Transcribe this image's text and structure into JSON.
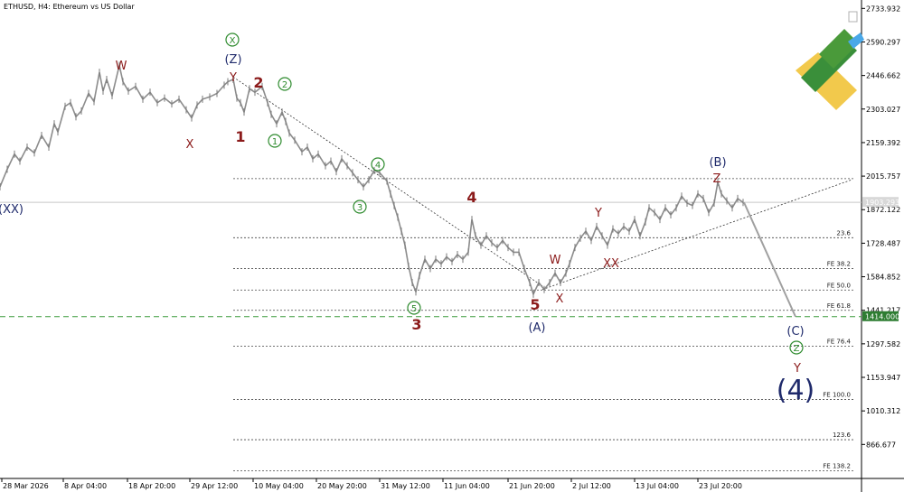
{
  "header": {
    "symbol_line": "ETHUSD, H4:  Ethereum vs US Dollar"
  },
  "chart_data": {
    "type": "line",
    "title": "ETHUSD, H4:  Ethereum vs US Dollar",
    "x_ticks": [
      "28 Mar 2026",
      "8 Apr 04:00",
      "18 Apr 20:00",
      "29 Apr 12:00",
      "10 May 04:00",
      "20 May 20:00",
      "31 May 12:00",
      "11 Jun 04:00",
      "21 Jun 20:00",
      "2 Jul 12:00",
      "13 Jul 04:00",
      "23 Jul 20:00"
    ],
    "y_ticks": [
      "2733.932",
      "2590.297",
      "2446.662",
      "2303.027",
      "2159.392",
      "2015.757",
      "1872.122",
      "1728.487",
      "1584.852",
      "1441.217",
      "1297.582",
      "1153.947",
      "1010.312",
      "866.677"
    ],
    "ylim": [
      721,
      2770
    ],
    "current_price_label": "1903.293",
    "target_price_label": "1414.000",
    "target_price": 1414.0,
    "fib_levels": [
      {
        "label": "",
        "price": 2005
      },
      {
        "label": "23.6",
        "price": 1752
      },
      {
        "label": "FE 38.2",
        "price": 1620
      },
      {
        "label": "FE 50.0",
        "price": 1528
      },
      {
        "label": "FE 61.8",
        "price": 1441
      },
      {
        "label": "FE 76.4",
        "price": 1287
      },
      {
        "label": "FE 100.0",
        "price": 1059
      },
      {
        "label": "123.6",
        "price": 887
      },
      {
        "label": "FE 138.2",
        "price": 754
      }
    ],
    "wave_labels": [
      {
        "text": "W",
        "color": "#8b1a1a",
        "style": "plain"
      },
      {
        "text": "X",
        "color": "#8b1a1a",
        "style": "plain"
      },
      {
        "text": "(XX)",
        "color": "#1f2a6b",
        "style": "plain"
      },
      {
        "text": "X",
        "color": "#2e8b2e",
        "style": "circle"
      },
      {
        "text": "(Z)",
        "color": "#1f2a6b",
        "style": "plain"
      },
      {
        "text": "Y",
        "color": "#8b1a1a",
        "style": "plain"
      },
      {
        "text": "2",
        "color": "#8b1a1a",
        "style": "bold"
      },
      {
        "text": "2",
        "color": "#2e8b2e",
        "style": "circle"
      },
      {
        "text": "1",
        "color": "#8b1a1a",
        "style": "bold"
      },
      {
        "text": "1",
        "color": "#2e8b2e",
        "style": "circle"
      },
      {
        "text": "4",
        "color": "#2e8b2e",
        "style": "circle"
      },
      {
        "text": "3",
        "color": "#2e8b2e",
        "style": "circle"
      },
      {
        "text": "5",
        "color": "#2e8b2e",
        "style": "circle"
      },
      {
        "text": "3",
        "color": "#8b1a1a",
        "style": "bold"
      },
      {
        "text": "4",
        "color": "#8b1a1a",
        "style": "bold"
      },
      {
        "text": "5",
        "color": "#8b1a1a",
        "style": "bold"
      },
      {
        "text": "(A)",
        "color": "#1f2a6b",
        "style": "plain"
      },
      {
        "text": "W",
        "color": "#8b1a1a",
        "style": "plain"
      },
      {
        "text": "X",
        "color": "#8b1a1a",
        "style": "plain"
      },
      {
        "text": "XX",
        "color": "#8b1a1a",
        "style": "plain"
      },
      {
        "text": "Y",
        "color": "#8b1a1a",
        "style": "plain"
      },
      {
        "text": "(B)",
        "color": "#1f2a6b",
        "style": "plain"
      },
      {
        "text": "Z",
        "color": "#8b1a1a",
        "style": "plain"
      },
      {
        "text": "(C)",
        "color": "#1f2a6b",
        "style": "plain"
      },
      {
        "text": "Z",
        "color": "#2e8b2e",
        "style": "circle"
      },
      {
        "text": "Y",
        "color": "#8b1a1a",
        "style": "plain"
      },
      {
        "text": "(4)",
        "color": "#1f2a6b",
        "style": "big"
      }
    ],
    "price_path": [
      [
        0,
        1970
      ],
      [
        8,
        2045
      ],
      [
        16,
        2110
      ],
      [
        22,
        2080
      ],
      [
        30,
        2140
      ],
      [
        38,
        2115
      ],
      [
        46,
        2190
      ],
      [
        54,
        2140
      ],
      [
        60,
        2240
      ],
      [
        64,
        2205
      ],
      [
        72,
        2315
      ],
      [
        78,
        2330
      ],
      [
        84,
        2270
      ],
      [
        90,
        2295
      ],
      [
        98,
        2370
      ],
      [
        104,
        2335
      ],
      [
        110,
        2460
      ],
      [
        114,
        2380
      ],
      [
        118,
        2430
      ],
      [
        124,
        2360
      ],
      [
        132,
        2490
      ],
      [
        136,
        2420
      ],
      [
        142,
        2380
      ],
      [
        150,
        2400
      ],
      [
        158,
        2345
      ],
      [
        166,
        2375
      ],
      [
        174,
        2330
      ],
      [
        182,
        2350
      ],
      [
        190,
        2325
      ],
      [
        198,
        2345
      ],
      [
        206,
        2300
      ],
      [
        212,
        2265
      ],
      [
        218,
        2320
      ],
      [
        224,
        2345
      ],
      [
        232,
        2355
      ],
      [
        240,
        2370
      ],
      [
        248,
        2405
      ],
      [
        252,
        2420
      ],
      [
        258,
        2430
      ],
      [
        262,
        2350
      ],
      [
        266,
        2330
      ],
      [
        270,
        2290
      ],
      [
        276,
        2390
      ],
      [
        282,
        2375
      ],
      [
        290,
        2400
      ],
      [
        296,
        2330
      ],
      [
        300,
        2280
      ],
      [
        306,
        2240
      ],
      [
        312,
        2290
      ],
      [
        316,
        2250
      ],
      [
        320,
        2200
      ],
      [
        326,
        2170
      ],
      [
        334,
        2120
      ],
      [
        340,
        2140
      ],
      [
        346,
        2090
      ],
      [
        352,
        2110
      ],
      [
        360,
        2060
      ],
      [
        366,
        2080
      ],
      [
        372,
        2035
      ],
      [
        378,
        2090
      ],
      [
        384,
        2060
      ],
      [
        390,
        2030
      ],
      [
        396,
        2000
      ],
      [
        402,
        1970
      ],
      [
        408,
        2000
      ],
      [
        414,
        2040
      ],
      [
        420,
        2030
      ],
      [
        428,
        1995
      ],
      [
        432,
        1940
      ],
      [
        436,
        1890
      ],
      [
        440,
        1840
      ],
      [
        444,
        1780
      ],
      [
        448,
        1720
      ],
      [
        452,
        1630
      ],
      [
        456,
        1560
      ],
      [
        460,
        1520
      ],
      [
        464,
        1590
      ],
      [
        470,
        1660
      ],
      [
        476,
        1620
      ],
      [
        482,
        1660
      ],
      [
        488,
        1640
      ],
      [
        494,
        1670
      ],
      [
        500,
        1650
      ],
      [
        506,
        1680
      ],
      [
        512,
        1660
      ],
      [
        518,
        1690
      ],
      [
        522,
        1830
      ],
      [
        526,
        1760
      ],
      [
        532,
        1720
      ],
      [
        538,
        1760
      ],
      [
        544,
        1730
      ],
      [
        550,
        1710
      ],
      [
        556,
        1740
      ],
      [
        562,
        1710
      ],
      [
        568,
        1690
      ],
      [
        574,
        1690
      ],
      [
        580,
        1620
      ],
      [
        586,
        1560
      ],
      [
        590,
        1510
      ],
      [
        596,
        1560
      ],
      [
        602,
        1530
      ],
      [
        608,
        1560
      ],
      [
        614,
        1600
      ],
      [
        620,
        1560
      ],
      [
        626,
        1600
      ],
      [
        630,
        1640
      ],
      [
        636,
        1710
      ],
      [
        642,
        1750
      ],
      [
        648,
        1780
      ],
      [
        654,
        1740
      ],
      [
        660,
        1800
      ],
      [
        666,
        1760
      ],
      [
        672,
        1720
      ],
      [
        678,
        1790
      ],
      [
        684,
        1770
      ],
      [
        690,
        1800
      ],
      [
        696,
        1780
      ],
      [
        702,
        1830
      ],
      [
        708,
        1760
      ],
      [
        714,
        1820
      ],
      [
        718,
        1880
      ],
      [
        724,
        1860
      ],
      [
        730,
        1830
      ],
      [
        736,
        1880
      ],
      [
        742,
        1850
      ],
      [
        748,
        1880
      ],
      [
        754,
        1930
      ],
      [
        760,
        1900
      ],
      [
        766,
        1890
      ],
      [
        772,
        1940
      ],
      [
        778,
        1920
      ],
      [
        784,
        1860
      ],
      [
        790,
        1900
      ],
      [
        794,
        1990
      ],
      [
        798,
        1940
      ],
      [
        804,
        1910
      ],
      [
        810,
        1880
      ],
      [
        816,
        1920
      ],
      [
        822,
        1903
      ]
    ],
    "wave_count_line": [
      [
        823,
        1903
      ],
      [
        880,
        1414
      ]
    ]
  }
}
